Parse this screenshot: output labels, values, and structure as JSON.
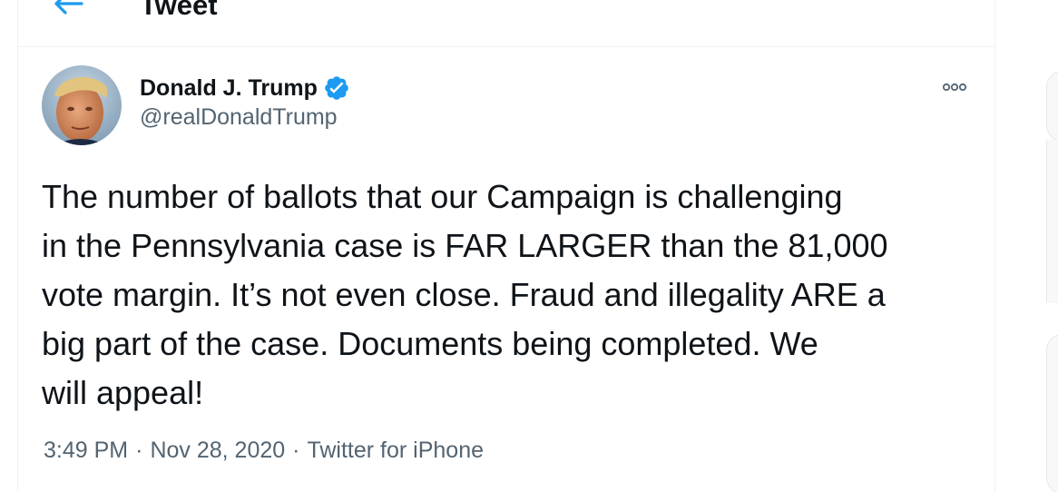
{
  "header": {
    "title": "Tweet",
    "back_icon": "arrow-left-icon"
  },
  "tweet": {
    "author": {
      "display_name": "Donald J. Trump",
      "handle": "@realDonaldTrump",
      "verified": true,
      "verified_icon": "verified-badge-icon"
    },
    "more_icon": "more-options-icon",
    "text_lines": [
      "The number of ballots that our Campaign is challenging",
      "in the Pennsylvania case is FAR LARGER than the 81,000",
      "vote margin. It’s not even close. Fraud and illegality ARE a",
      "big part of the case. Documents being completed. We",
      "will appeal!"
    ],
    "meta": {
      "time": "3:49 PM",
      "separator": "·",
      "date": "Nov 28, 2020",
      "source": "Twitter for iPhone"
    }
  },
  "colors": {
    "accent": "#1d9bf0",
    "text_primary": "#0f1419",
    "text_secondary": "#536471",
    "border": "#eff3f4"
  }
}
